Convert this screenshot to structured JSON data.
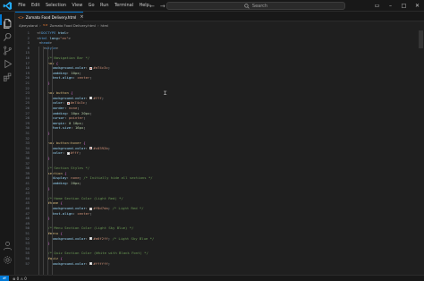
{
  "menu": [
    "File",
    "Edit",
    "Selection",
    "View",
    "Go",
    "Run",
    "Terminal",
    "Help"
  ],
  "search": {
    "label": "Search"
  },
  "colors": {
    "accent": "#0078d4",
    "editor_bg": "#1f1f1f",
    "chrome_bg": "#181818"
  },
  "tab": {
    "label": "Zomato Food Delivery.html",
    "close": "×",
    "icon": "html-file-icon"
  },
  "breadcrumb": {
    "items": [
      "Ajeeyoland",
      "Zomato Food Delivery.html",
      "html"
    ]
  },
  "status": {
    "errors": "⊗ 0 ⚠ 0"
  },
  "editor": {
    "lines": [
      {
        "n": "1",
        "code": "<!DOCTYPE html>"
      },
      {
        "n": "2",
        "code": "<html lang=\"en\">"
      },
      {
        "n": "3",
        "code": "<head>"
      },
      {
        "n": "8",
        "code": "<style>"
      },
      {
        "n": "15",
        "code": ""
      },
      {
        "n": "16",
        "code": "/* Navigation Bar */"
      },
      {
        "n": "17",
        "code": "nav {"
      },
      {
        "n": "18",
        "code": "background-color: #e74c3c;"
      },
      {
        "n": "19",
        "code": "padding: 10px;"
      },
      {
        "n": "20",
        "code": "text-align: center;"
      },
      {
        "n": "21",
        "code": "}"
      },
      {
        "n": "22",
        "code": ""
      },
      {
        "n": "23",
        "code": "nav button {"
      },
      {
        "n": "24",
        "code": "background-color: #fff;"
      },
      {
        "n": "25",
        "code": "color: #e74c3c;"
      },
      {
        "n": "26",
        "code": "border: none;"
      },
      {
        "n": "27",
        "code": "padding: 10px 20px;"
      },
      {
        "n": "28",
        "code": "cursor: pointer;"
      },
      {
        "n": "29",
        "code": "margin: 0 10px;"
      },
      {
        "n": "30",
        "code": "font-size: 16px;"
      },
      {
        "n": "31",
        "code": "}"
      },
      {
        "n": "32",
        "code": ""
      },
      {
        "n": "33",
        "code": "nav button:hover {"
      },
      {
        "n": "34",
        "code": "background-color: #c0392b;"
      },
      {
        "n": "35",
        "code": "color: #fff;"
      },
      {
        "n": "36",
        "code": "}"
      },
      {
        "n": "37",
        "code": ""
      },
      {
        "n": "38",
        "code": "/* Section Styles */"
      },
      {
        "n": "39",
        "code": "section {"
      },
      {
        "n": "40",
        "code": "display: none; /* Initially hide all sections */"
      },
      {
        "n": "41",
        "code": "padding: 20px;"
      },
      {
        "n": "42",
        "code": "}"
      },
      {
        "n": "43",
        "code": ""
      },
      {
        "n": "44",
        "code": "/* Home Section Color (Light Red) */"
      },
      {
        "n": "45",
        "code": "#home {"
      },
      {
        "n": "46",
        "code": "background-color: #f8d7da; /* Light Red */"
      },
      {
        "n": "47",
        "code": "text-align: center;"
      },
      {
        "n": "48",
        "code": "}"
      },
      {
        "n": "49",
        "code": ""
      },
      {
        "n": "50",
        "code": "/* Menu Section Color (Light Sky Blue) */"
      },
      {
        "n": "51",
        "code": "#menu {"
      },
      {
        "n": "52",
        "code": "background-color: #e6f2ff; /* Light Sky Blue */"
      },
      {
        "n": "53",
        "code": "}"
      },
      {
        "n": "54",
        "code": ""
      },
      {
        "n": "55",
        "code": "/* Quiz Section Color (White with Black Font) */"
      },
      {
        "n": "56",
        "code": "#quiz {"
      },
      {
        "n": "57",
        "code": "background-color: #ffffff;"
      }
    ]
  }
}
